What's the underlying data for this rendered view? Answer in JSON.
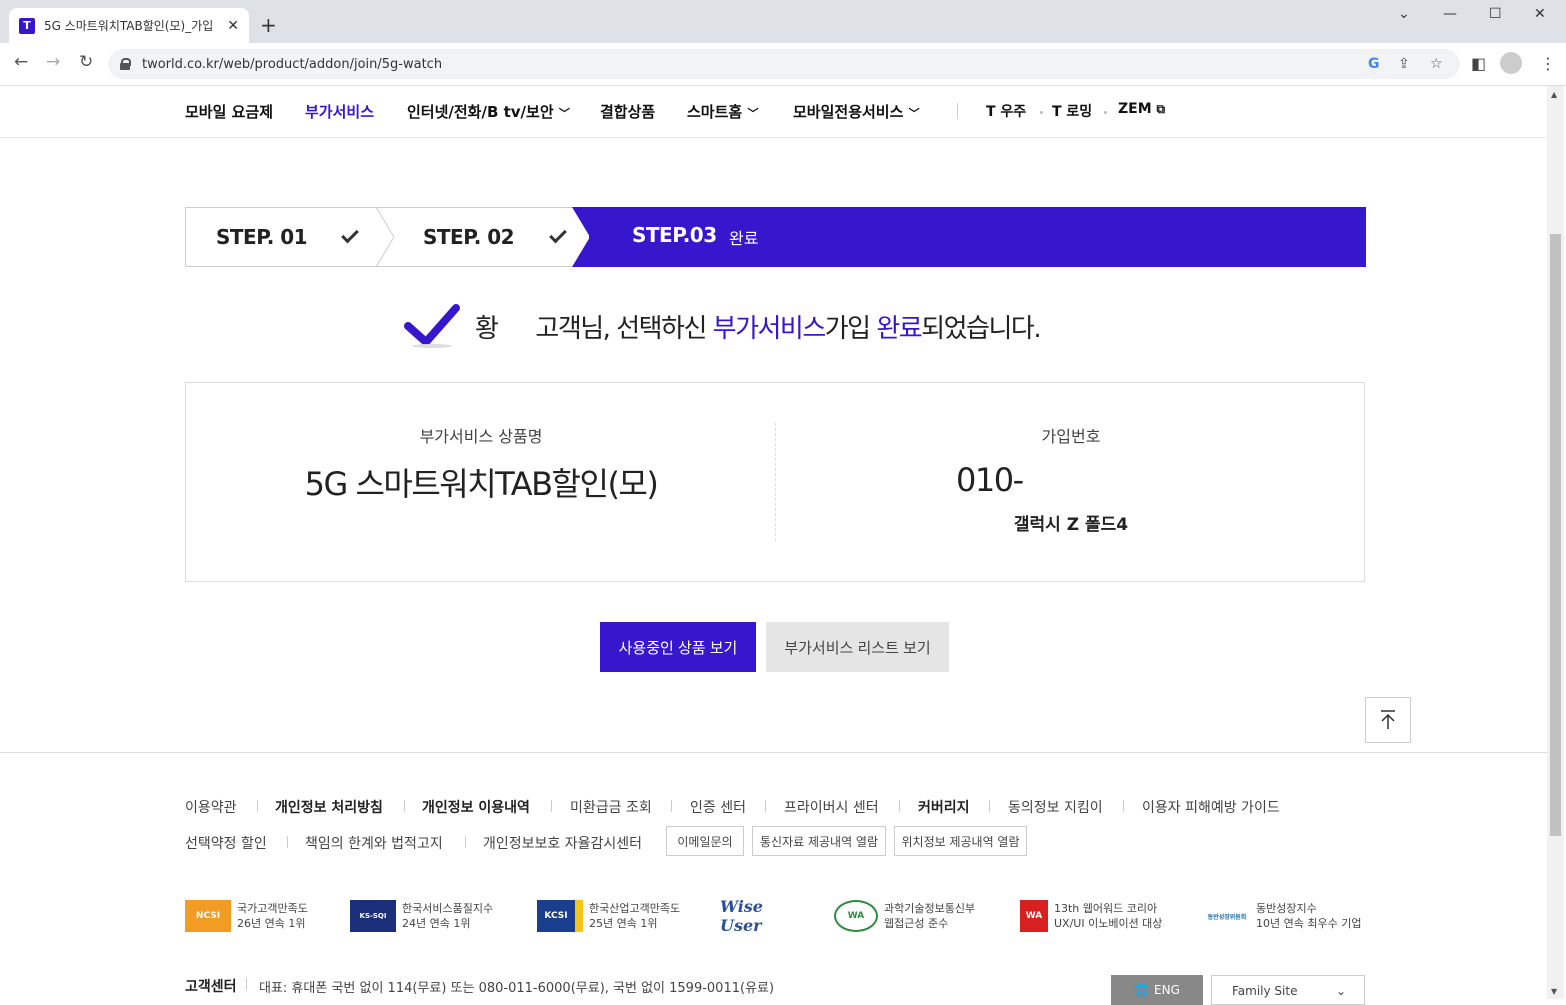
{
  "browser": {
    "tab_title": "5G 스마트워치TAB할인(모)_가입",
    "url": "tworld.co.kr/web/product/addon/join/5g-watch"
  },
  "gnb": {
    "items": [
      {
        "label": "모바일 요금제"
      },
      {
        "label": "부가서비스"
      },
      {
        "label": "인터넷/전화/B tv/보안"
      },
      {
        "label": "결합상품"
      },
      {
        "label": "스마트홈"
      },
      {
        "label": "모바일전용서비스"
      },
      {
        "label": "T 우주"
      },
      {
        "label": "T 로밍"
      },
      {
        "label": "ZEM"
      }
    ]
  },
  "steps": {
    "step1": "STEP. 01",
    "step2": "STEP. 02",
    "step3": "STEP.03",
    "step3_status": "완료"
  },
  "completion": {
    "name": "황",
    "msg_prefix": "고객님, 선택하신 ",
    "msg_hl1": "부가서비스",
    "msg_mid": "가입 ",
    "msg_hl2": "완료",
    "msg_suffix": "되었습니다."
  },
  "info": {
    "product_label": "부가서비스 상품명",
    "product_value": "5G 스마트워치TAB할인(모)",
    "number_label": "가입번호",
    "number_value": "010-",
    "device": "갤럭시 Z 폴드4"
  },
  "buttons": {
    "primary": "사용중인 상품 보기",
    "secondary": "부가서비스 리스트 보기"
  },
  "footer": {
    "links_row1": [
      {
        "label": "이용약관"
      },
      {
        "label": "개인정보 처리방침"
      },
      {
        "label": "개인정보 이용내역"
      },
      {
        "label": "미환급금 조회"
      },
      {
        "label": "인증 센터"
      },
      {
        "label": "프라이버시 센터"
      },
      {
        "label": "커버리지"
      },
      {
        "label": "동의정보 지킴이"
      },
      {
        "label": "이용자 피해예방 가이드"
      }
    ],
    "links_row2": [
      {
        "label": "선택약정 할인"
      },
      {
        "label": "책임의 한계와 법적고지"
      },
      {
        "label": "개인정보보호 자율감시센터"
      }
    ],
    "boxed_buttons": [
      {
        "label": "이메일문의"
      },
      {
        "label": "통신자료 제공내역 열람"
      },
      {
        "label": "위치정보 제공내역 열람"
      }
    ],
    "awards": [
      {
        "logo": "NCSI",
        "line1": "국가고객만족도",
        "line2": "26년 연속 1위",
        "color": "#f39c23"
      },
      {
        "logo": "KS-SQI",
        "line1": "한국서비스품질지수",
        "line2": "24년 연속 1위",
        "color": "#1b2f7a"
      },
      {
        "logo": "KCSI",
        "line1": "한국산업고객만족도",
        "line2": "25년 연속 1위",
        "color": "#1b3f8f"
      },
      {
        "logo": "Wise User",
        "line1": "",
        "line2": "",
        "color": "#2a4f9c"
      },
      {
        "logo": "WA",
        "line1": "과학기술정보통신부",
        "line2": "웹접근성 준수",
        "color": "#2e8b3d"
      },
      {
        "logo": "WA",
        "line1": "13th 웹어워드 코리아",
        "line2": "UX/UI 이노베이션 대상",
        "color": "#d92020"
      },
      {
        "logo": "동반성장위원회",
        "line1": "동반성장지수",
        "line2": "10년 연속 최우수 기업",
        "color": "#1e6fb8"
      }
    ],
    "cs_label": "고객센터",
    "cs_text": "대표: 휴대폰 국번 없이 114(무료) 또는 080-011-6000(무료), 국번 없이 1599-0011(유료)",
    "eng": "ENG",
    "family": "Family Site"
  },
  "colors": {
    "brand": "#3617ce"
  }
}
